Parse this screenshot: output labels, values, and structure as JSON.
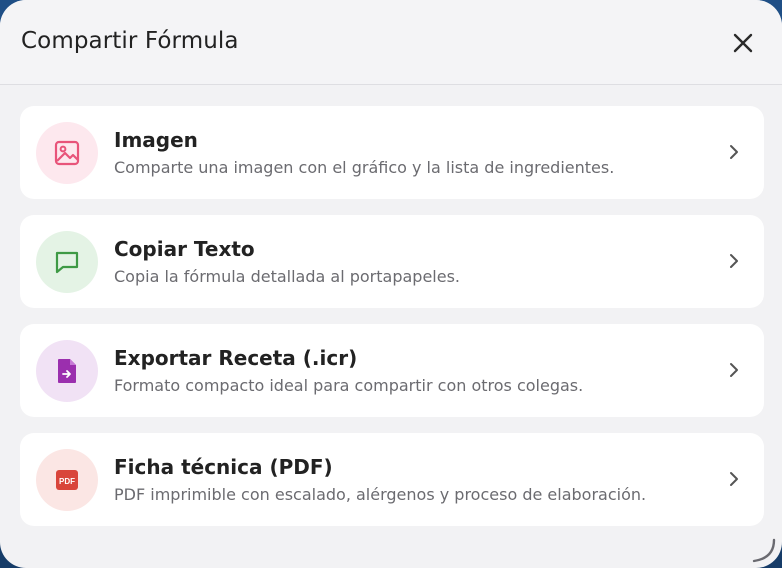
{
  "dialog": {
    "title": "Compartir Fórmula"
  },
  "options": [
    {
      "title": "Imagen",
      "description": "Comparte una imagen con el gráfico y la lista de ingredientes.",
      "icon": "image-icon",
      "icon_color": "#e8547a",
      "icon_bg": "#fde8ee"
    },
    {
      "title": "Copiar Texto",
      "description": "Copia la fórmula detallada al portapapeles.",
      "icon": "message-icon",
      "icon_color": "#3e9a45",
      "icon_bg": "#e4f3e5"
    },
    {
      "title": "Exportar Receta (.icr)",
      "description": "Formato compacto ideal para compartir con otros colegas.",
      "icon": "file-export-icon",
      "icon_color": "#9b2fae",
      "icon_bg": "#f1e2f5"
    },
    {
      "title": "Ficha técnica (PDF)",
      "description": "PDF imprimible con escalado, alérgenos y proceso de elaboración.",
      "icon": "pdf-icon",
      "icon_color": "#d9453b",
      "icon_bg": "#fbe6e4",
      "icon_text": "PDF"
    }
  ]
}
